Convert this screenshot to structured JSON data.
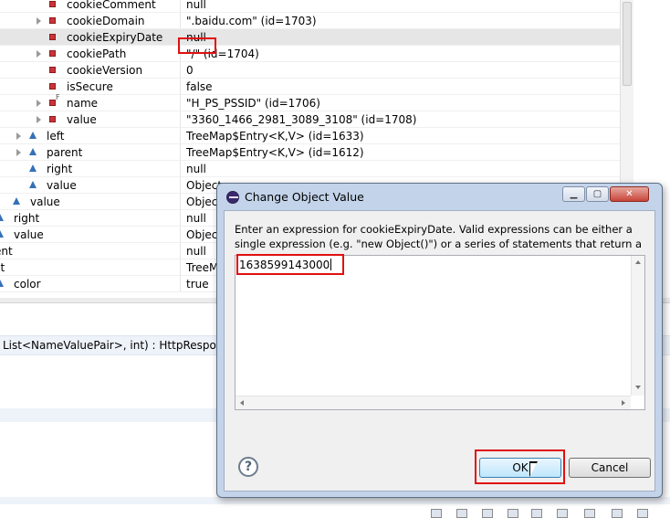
{
  "variables": [
    {
      "name": "cookieComment",
      "value": "null",
      "icon": "field-red-icon",
      "expandable": false,
      "indent": 3
    },
    {
      "name": "cookieDomain",
      "value": "\".baidu.com\" (id=1703)",
      "icon": "field-red-icon",
      "expandable": true,
      "indent": 3
    },
    {
      "name": "cookieExpiryDate",
      "value": "null",
      "icon": "field-red-icon",
      "expandable": false,
      "indent": 3,
      "selected": true
    },
    {
      "name": "cookiePath",
      "value": "\"/\" (id=1704)",
      "icon": "field-red-icon",
      "expandable": true,
      "indent": 3
    },
    {
      "name": "cookieVersion",
      "value": "0",
      "icon": "field-red-icon",
      "expandable": false,
      "indent": 3
    },
    {
      "name": "isSecure",
      "value": "false",
      "icon": "field-red-icon",
      "expandable": false,
      "indent": 3
    },
    {
      "name": "name",
      "value": "\"H_PS_PSSID\" (id=1706)",
      "icon": "field-red-final-icon",
      "expandable": true,
      "indent": 3
    },
    {
      "name": "value",
      "value": "\"3360_1466_2981_3089_3108\" (id=1708)",
      "icon": "field-red-icon",
      "expandable": true,
      "indent": 3
    },
    {
      "name": "left",
      "value": "TreeMap$Entry<K,V>  (id=1633)",
      "icon": "field-blue-icon",
      "expandable": true,
      "indent": 2
    },
    {
      "name": "parent",
      "value": "TreeMap$Entry<K,V>  (id=1612)",
      "icon": "field-blue-icon",
      "expandable": true,
      "indent": 2
    },
    {
      "name": "right",
      "value": "null",
      "icon": "field-blue-icon",
      "expandable": false,
      "indent": 2
    },
    {
      "name": "value",
      "value": "Object",
      "icon": "field-blue-icon",
      "expandable": false,
      "indent": 2
    },
    {
      "name": "value",
      "value": "Object",
      "icon": "field-blue-icon",
      "expandable": false,
      "indent": 1
    },
    {
      "name": "right",
      "value": "null",
      "icon": "field-blue-icon",
      "expandable": false,
      "indent": 0
    },
    {
      "name": "value",
      "value": "Object",
      "icon": "field-blue-icon",
      "expandable": false,
      "indent": 0
    },
    {
      "name": "arent",
      "value": "null",
      "icon": "",
      "expandable": false,
      "indent": -1
    },
    {
      "name": "ight",
      "value": "TreeM",
      "icon": "",
      "expandable": false,
      "indent": -1
    },
    {
      "name": "color",
      "value": "true",
      "icon": "field-blue-icon",
      "expandable": false,
      "indent": 0
    }
  ],
  "detail": {
    "signature": "List<NameValuePair>, int) : HttpResponse"
  },
  "dialog": {
    "title": "Change Object Value",
    "message": "Enter an expression for cookieExpiryDate. Valid expressions can be either a single expression (e.g. \"new Object()\") or a series of statements that return a value.",
    "expression": "1638599143000",
    "ok_label": "OK",
    "cancel_label": "Cancel",
    "help_symbol": "?",
    "min_symbol": "▁",
    "max_symbol": "▢",
    "close_symbol": "✕"
  },
  "colors": {
    "highlight": "#e01010",
    "field_private": "#c8343a",
    "field_public": "#3570b8",
    "dialog_frame": "#c3d4ea"
  }
}
